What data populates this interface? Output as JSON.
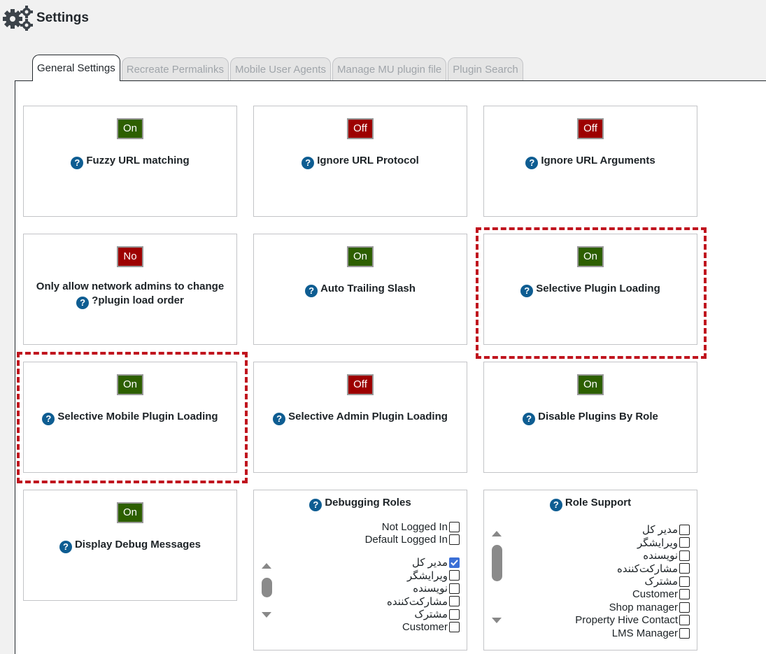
{
  "header": {
    "title": "Settings"
  },
  "tabs": [
    {
      "label": "General Settings",
      "active": true
    },
    {
      "label": "Recreate Permalinks",
      "active": false
    },
    {
      "label": "Mobile User Agents",
      "active": false
    },
    {
      "label": "Manage MU plugin file",
      "active": false
    },
    {
      "label": "Plugin Search",
      "active": false
    }
  ],
  "settings": {
    "fuzzy_url": {
      "state": "On",
      "label": "Fuzzy URL matching"
    },
    "ignore_protocol": {
      "state": "Off",
      "label": "Ignore URL Protocol"
    },
    "ignore_arguments": {
      "state": "Off",
      "label": "Ignore URL Arguments"
    },
    "network_admins": {
      "state": "No",
      "label_line1": "Only allow network admins to change",
      "label_line2": "?plugin load order"
    },
    "trailing_slash": {
      "state": "On",
      "label": "Auto Trailing Slash"
    },
    "selective_plugin": {
      "state": "On",
      "label": "Selective Plugin Loading"
    },
    "selective_mobile": {
      "state": "On",
      "label": "Selective Mobile Plugin Loading"
    },
    "selective_admin": {
      "state": "Off",
      "label": "Selective Admin Plugin Loading"
    },
    "disable_by_role": {
      "state": "On",
      "label": "Disable Plugins By Role"
    },
    "debug_messages": {
      "state": "On",
      "label": "Display Debug Messages"
    }
  },
  "debugging_roles": {
    "title": "Debugging Roles",
    "top_items": [
      {
        "label": "Not Logged In",
        "checked": false
      },
      {
        "label": "Default Logged In",
        "checked": false
      }
    ],
    "items": [
      {
        "label": "مدیر کل",
        "checked": true
      },
      {
        "label": "ویرایشگر",
        "checked": false
      },
      {
        "label": "نویسنده",
        "checked": false
      },
      {
        "label": "مشارکت‌کننده",
        "checked": false
      },
      {
        "label": "مشترک",
        "checked": false
      },
      {
        "label": "Customer",
        "checked": false
      }
    ]
  },
  "role_support": {
    "title": "Role Support",
    "items": [
      {
        "label": "مدیر کل",
        "checked": false
      },
      {
        "label": "ویرایشگر",
        "checked": false
      },
      {
        "label": "نویسنده",
        "checked": false
      },
      {
        "label": "مشارکت‌کننده",
        "checked": false
      },
      {
        "label": "مشترک",
        "checked": false
      },
      {
        "label": "Customer",
        "checked": false
      },
      {
        "label": "Shop manager",
        "checked": false
      },
      {
        "label": "Property Hive Contact",
        "checked": false
      },
      {
        "label": "LMS Manager",
        "checked": false
      }
    ]
  },
  "colors": {
    "on": "#2d5f00",
    "off": "#9d0000",
    "highlight": "#c0141e",
    "help": "#0e5d92"
  }
}
